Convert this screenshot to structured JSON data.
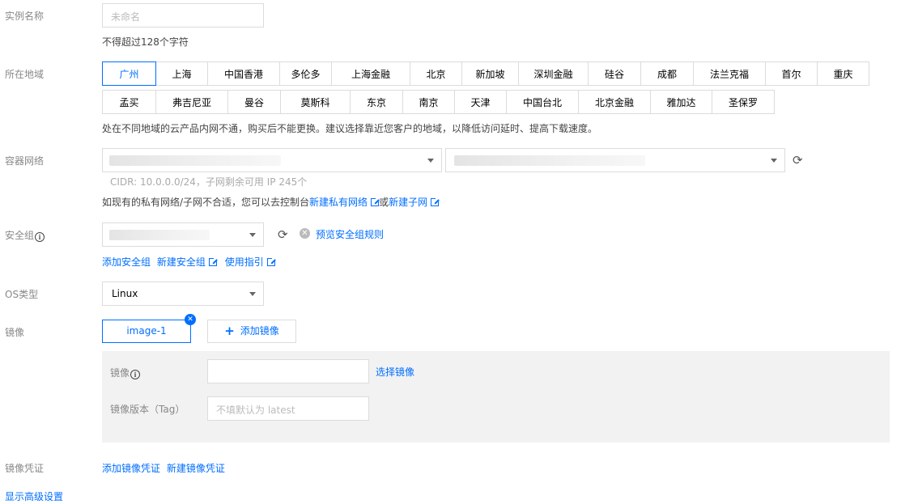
{
  "instance_name": {
    "label": "实例名称",
    "placeholder": "未命名",
    "hint": "不得超过128个字符"
  },
  "region": {
    "label": "所在地域",
    "row1": [
      "广州",
      "上海",
      "中国香港",
      "多伦多",
      "上海金融",
      "北京",
      "新加坡",
      "深圳金融",
      "硅谷",
      "成都",
      "法兰克福",
      "首尔",
      "重庆"
    ],
    "row2": [
      "孟买",
      "弗吉尼亚",
      "曼谷",
      "莫斯科",
      "东京",
      "南京",
      "天津",
      "中国台北",
      "北京金融",
      "雅加达",
      "圣保罗"
    ],
    "selected": "广州",
    "hint": "处在不同地域的云产品内网不通，购买后不能更换。建议选择靠近您客户的地域，以降低访问延时、提高下载速度。"
  },
  "network": {
    "label": "容器网络",
    "cidr": "CIDR: 10.0.0.0/24，子网剩余可用 IP 245个",
    "hint_prefix": "如现有的私有网络/子网不合适，您可以去控制台",
    "new_vpc": "新建私有网络",
    "or": "或",
    "new_subnet": "新建子网"
  },
  "security_group": {
    "label": "安全组",
    "preview": "预览安全组规则",
    "add": "添加安全组",
    "new": "新建安全组",
    "guide": "使用指引"
  },
  "os": {
    "label": "OS类型",
    "value": "Linux"
  },
  "image": {
    "label": "镜像",
    "tab": "image-1",
    "add_button": "添加镜像",
    "field_label": "镜像",
    "select_link": "选择镜像",
    "tag_label": "镜像版本（Tag）",
    "tag_placeholder": "不填默认为 latest"
  },
  "credentials": {
    "label": "镜像凭证",
    "add": "添加镜像凭证",
    "new": "新建镜像凭证"
  },
  "advanced": "显示高级设置",
  "colors": {
    "accent": "#006eff",
    "border": "#dcdcdc",
    "panel": "#f2f2f2"
  }
}
